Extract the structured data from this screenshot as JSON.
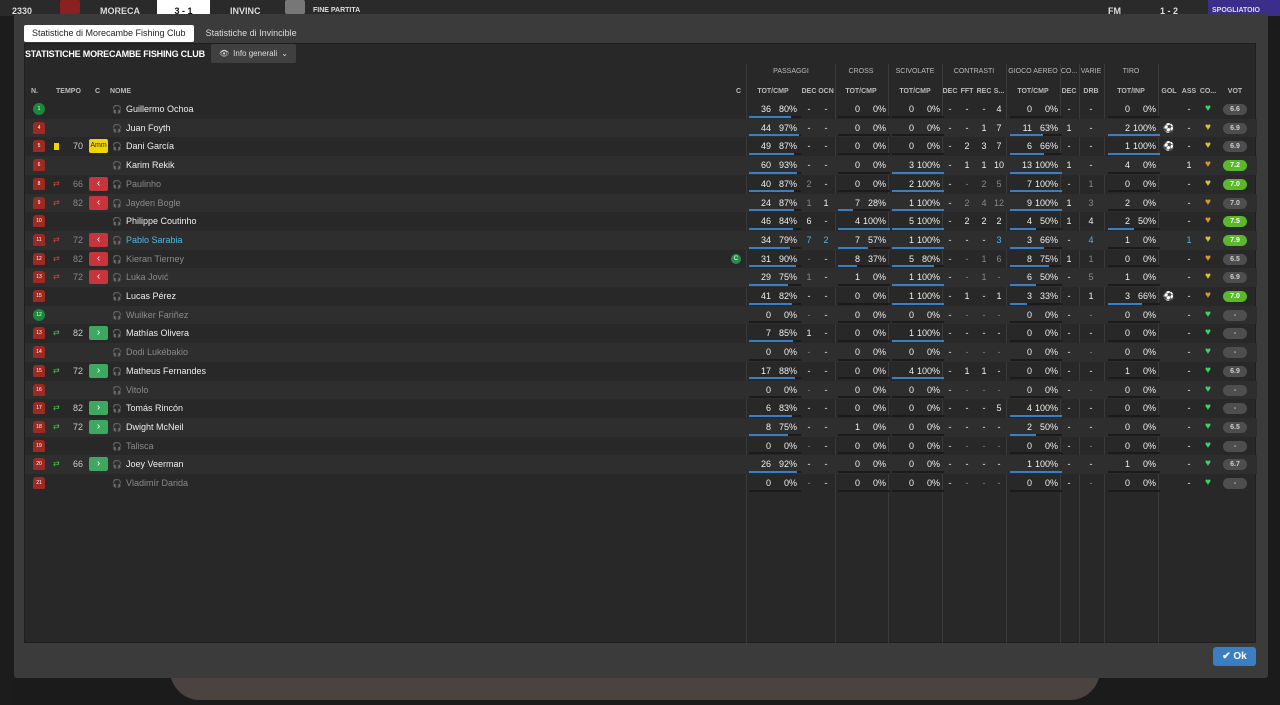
{
  "topbar": {
    "clock": "2330",
    "team1": "MORECA",
    "score": "3 - 1",
    "team2": "INVINC",
    "status": "FINE PARTITA",
    "fm": "FM",
    "right_score": "1 - 2",
    "right_btn": "SPOGLIATOIO"
  },
  "tabs": [
    "Statistiche di Morecambe Fishing Club",
    "Statistiche di Invincible"
  ],
  "panel_title": "STATISTICHE MORECAMBE FISHING CLUB",
  "view_select": "Info generali",
  "groups": [
    "PASSAGGI",
    "CROSS",
    "SCIVOLATE",
    "CONTRASTI",
    "GIOCO AEREO",
    "CO...",
    "VARIE",
    "TIRO"
  ],
  "col_headers": {
    "n": "N.",
    "tempo": "TEMPO",
    "c": "C",
    "nome": "NOME",
    "c2": "C",
    "pas_tc": "TOT/CMP",
    "pas_dec": "DEC",
    "pas_ocn": "OCN",
    "cross_tc": "TOT/CMP",
    "sciv_tc": "TOT/CMP",
    "con_dec": "DEC",
    "con_fft": "FFT",
    "con_rec": "REC",
    "con_s": "S...",
    "aer_tc": "TOT/CMP",
    "co_dec": "DEC",
    "var_drb": "DRB",
    "tiro_ti": "TOT/INP",
    "gol": "GOL",
    "ass": "ASS",
    "co": "CO...",
    "vot": "VOT"
  },
  "players": [
    {
      "num": "1",
      "gk": true,
      "card": "",
      "icon": "",
      "tempo": "",
      "sub": "",
      "name": "Guillermo Ochoa",
      "style": "",
      "cap": "",
      "p": [
        "36",
        "80%"
      ],
      "pdec": "-",
      "pocn": "-",
      "cr": [
        "0",
        "0%"
      ],
      "sc": [
        "0",
        "0%"
      ],
      "cdec": "-",
      "fft": "-",
      "rec": "-",
      "s": "4",
      "ae": [
        "0",
        "0%"
      ],
      "codec": "-",
      "drb": "-",
      "ti": [
        "0",
        "0%"
      ],
      "gol": "",
      "ass": "-",
      "heart": "g",
      "vot": "6.6",
      "votc": "n"
    },
    {
      "num": "4",
      "gk": false,
      "card": "",
      "icon": "",
      "tempo": "",
      "sub": "",
      "name": "Juan Foyth",
      "style": "",
      "cap": "",
      "p": [
        "44",
        "97%"
      ],
      "pdec": "-",
      "pocn": "-",
      "cr": [
        "0",
        "0%"
      ],
      "sc": [
        "0",
        "0%"
      ],
      "cdec": "-",
      "fft": "-",
      "rec": "1",
      "s": "7",
      "ae": [
        "11",
        "63%"
      ],
      "codec": "1",
      "drb": "-",
      "ti": [
        "2",
        "100%"
      ],
      "gol": "⚽",
      "ass": "-",
      "heart": "y",
      "vot": "6.9",
      "votc": "n"
    },
    {
      "num": "5",
      "gk": false,
      "card": "y",
      "icon": "",
      "tempo": "70",
      "sub": "amm",
      "name": "Dani García",
      "style": "",
      "cap": "",
      "p": [
        "49",
        "87%"
      ],
      "pdec": "-",
      "pocn": "-",
      "cr": [
        "0",
        "0%"
      ],
      "sc": [
        "0",
        "0%"
      ],
      "cdec": "-",
      "fft": "2",
      "rec": "3",
      "s": "7",
      "ae": [
        "6",
        "66%"
      ],
      "codec": "-",
      "drb": "-",
      "ti": [
        "1",
        "100%"
      ],
      "gol": "⚽",
      "ass": "-",
      "heart": "y",
      "vot": "6.9",
      "votc": "n"
    },
    {
      "num": "6",
      "gk": false,
      "card": "",
      "icon": "",
      "tempo": "",
      "sub": "",
      "name": "Karim Rekik",
      "style": "",
      "cap": "",
      "p": [
        "60",
        "93%"
      ],
      "pdec": "-",
      "pocn": "-",
      "cr": [
        "0",
        "0%"
      ],
      "sc": [
        "3",
        "100%"
      ],
      "cdec": "-",
      "fft": "1",
      "rec": "1",
      "s": "10",
      "ae": [
        "13",
        "100%"
      ],
      "codec": "1",
      "drb": "-",
      "ti": [
        "4",
        "0%"
      ],
      "gol": "",
      "ass": "1",
      "heart": "o",
      "vot": "7.2",
      "votc": "g"
    },
    {
      "num": "8",
      "gk": false,
      "card": "",
      "icon": "out",
      "tempo": "66",
      "sub": "out",
      "name": "Paulinho",
      "style": "dim",
      "cap": "",
      "p": [
        "40",
        "87%"
      ],
      "pdec": "2",
      "pocn": "-",
      "cr": [
        "0",
        "0%"
      ],
      "sc": [
        "2",
        "100%"
      ],
      "cdec": "-",
      "fft": "-",
      "rec": "2",
      "s": "5",
      "ae": [
        "7",
        "100%"
      ],
      "codec": "-",
      "drb": "1",
      "ti": [
        "0",
        "0%"
      ],
      "gol": "",
      "ass": "-",
      "heart": "y",
      "vot": "7.0",
      "votc": "g"
    },
    {
      "num": "9",
      "gk": false,
      "card": "",
      "icon": "out",
      "tempo": "82",
      "sub": "out",
      "name": "Jayden Bogle",
      "style": "dim",
      "cap": "",
      "p": [
        "24",
        "87%"
      ],
      "pdec": "1",
      "pocn": "1",
      "cr": [
        "7",
        "28%"
      ],
      "sc": [
        "1",
        "100%"
      ],
      "cdec": "-",
      "fft": "2",
      "rec": "4",
      "s": "12",
      "ae": [
        "9",
        "100%"
      ],
      "codec": "1",
      "drb": "3",
      "ti": [
        "2",
        "0%"
      ],
      "gol": "",
      "ass": "-",
      "heart": "o",
      "vot": "7.0",
      "votc": "n"
    },
    {
      "num": "10",
      "gk": false,
      "card": "",
      "icon": "",
      "tempo": "",
      "sub": "",
      "name": "Philippe Coutinho",
      "style": "",
      "cap": "",
      "p": [
        "46",
        "84%"
      ],
      "pdec": "6",
      "pocn": "-",
      "cr": [
        "4",
        "100%"
      ],
      "sc": [
        "5",
        "100%"
      ],
      "cdec": "-",
      "fft": "2",
      "rec": "2",
      "s": "2",
      "ae": [
        "4",
        "50%"
      ],
      "codec": "1",
      "drb": "4",
      "ti": [
        "2",
        "50%"
      ],
      "gol": "",
      "ass": "-",
      "heart": "o",
      "vot": "7.5",
      "votc": "g"
    },
    {
      "num": "11",
      "gk": false,
      "card": "",
      "icon": "out",
      "tempo": "72",
      "sub": "out",
      "name": "Pablo Sarabia",
      "style": "hl",
      "cap": "",
      "p": [
        "34",
        "79%"
      ],
      "pdec": "7",
      "pocn": "2",
      "cr": [
        "7",
        "57%"
      ],
      "sc": [
        "1",
        "100%"
      ],
      "cdec": "-",
      "fft": "-",
      "rec": "-",
      "s": "3",
      "ae": [
        "3",
        "66%"
      ],
      "codec": "-",
      "drb": "4",
      "ti": [
        "1",
        "0%"
      ],
      "gol": "",
      "ass": "1",
      "heart": "y",
      "vot": "7.9",
      "votc": "g"
    },
    {
      "num": "12",
      "gk": false,
      "card": "",
      "icon": "out",
      "tempo": "82",
      "sub": "out",
      "name": "Kieran Tierney",
      "style": "dim",
      "cap": "C",
      "p": [
        "31",
        "90%"
      ],
      "pdec": "-",
      "pocn": "-",
      "cr": [
        "8",
        "37%"
      ],
      "sc": [
        "5",
        "80%"
      ],
      "cdec": "-",
      "fft": "-",
      "rec": "1",
      "s": "6",
      "ae": [
        "8",
        "75%"
      ],
      "codec": "1",
      "drb": "1",
      "ti": [
        "0",
        "0%"
      ],
      "gol": "",
      "ass": "-",
      "heart": "o",
      "vot": "6.5",
      "votc": "n"
    },
    {
      "num": "13",
      "gk": false,
      "card": "",
      "icon": "out",
      "tempo": "72",
      "sub": "out",
      "name": "Luka Jović",
      "style": "dim",
      "cap": "",
      "p": [
        "29",
        "75%"
      ],
      "pdec": "1",
      "pocn": "-",
      "cr": [
        "1",
        "0%"
      ],
      "sc": [
        "1",
        "100%"
      ],
      "cdec": "-",
      "fft": "-",
      "rec": "1",
      "s": "-",
      "ae": [
        "6",
        "50%"
      ],
      "codec": "-",
      "drb": "5",
      "ti": [
        "1",
        "0%"
      ],
      "gol": "",
      "ass": "-",
      "heart": "y",
      "vot": "6.9",
      "votc": "n"
    },
    {
      "num": "15",
      "gk": false,
      "card": "",
      "icon": "",
      "tempo": "",
      "sub": "",
      "name": "Lucas Pérez",
      "style": "",
      "cap": "",
      "p": [
        "41",
        "82%"
      ],
      "pdec": "-",
      "pocn": "-",
      "cr": [
        "0",
        "0%"
      ],
      "sc": [
        "1",
        "100%"
      ],
      "cdec": "-",
      "fft": "1",
      "rec": "-",
      "s": "1",
      "ae": [
        "3",
        "33%"
      ],
      "codec": "-",
      "drb": "1",
      "ti": [
        "3",
        "66%"
      ],
      "gol": "⚽",
      "ass": "-",
      "heart": "o",
      "vot": "7.0",
      "votc": "g"
    },
    {
      "num": "12",
      "gk": true,
      "card": "",
      "icon": "",
      "tempo": "",
      "sub": "",
      "name": "Wuilker Fariñez",
      "style": "dim",
      "cap": "",
      "p": [
        "0",
        "0%"
      ],
      "pdec": "-",
      "pocn": "-",
      "cr": [
        "0",
        "0%"
      ],
      "sc": [
        "0",
        "0%"
      ],
      "cdec": "-",
      "fft": "-",
      "rec": "-",
      "s": "-",
      "ae": [
        "0",
        "0%"
      ],
      "codec": "-",
      "drb": "-",
      "ti": [
        "0",
        "0%"
      ],
      "gol": "",
      "ass": "-",
      "heart": "g",
      "vot": "-",
      "votc": "n"
    },
    {
      "num": "13",
      "gk": false,
      "card": "",
      "icon": "in",
      "tempo": "82",
      "sub": "in",
      "name": "Mathías Olivera",
      "style": "",
      "cap": "",
      "p": [
        "7",
        "85%"
      ],
      "pdec": "1",
      "pocn": "-",
      "cr": [
        "0",
        "0%"
      ],
      "sc": [
        "1",
        "100%"
      ],
      "cdec": "-",
      "fft": "-",
      "rec": "-",
      "s": "-",
      "ae": [
        "0",
        "0%"
      ],
      "codec": "-",
      "drb": "-",
      "ti": [
        "0",
        "0%"
      ],
      "gol": "",
      "ass": "-",
      "heart": "g",
      "vot": "-",
      "votc": "n"
    },
    {
      "num": "14",
      "gk": false,
      "card": "",
      "icon": "",
      "tempo": "",
      "sub": "",
      "name": "Dodi Lukébakio",
      "style": "dim",
      "cap": "",
      "p": [
        "0",
        "0%"
      ],
      "pdec": "-",
      "pocn": "-",
      "cr": [
        "0",
        "0%"
      ],
      "sc": [
        "0",
        "0%"
      ],
      "cdec": "-",
      "fft": "-",
      "rec": "-",
      "s": "-",
      "ae": [
        "0",
        "0%"
      ],
      "codec": "-",
      "drb": "-",
      "ti": [
        "0",
        "0%"
      ],
      "gol": "",
      "ass": "-",
      "heart": "g",
      "vot": "-",
      "votc": "n"
    },
    {
      "num": "15",
      "gk": false,
      "card": "",
      "icon": "in",
      "tempo": "72",
      "sub": "in",
      "name": "Matheus Fernandes",
      "style": "",
      "cap": "",
      "p": [
        "17",
        "88%"
      ],
      "pdec": "-",
      "pocn": "-",
      "cr": [
        "0",
        "0%"
      ],
      "sc": [
        "4",
        "100%"
      ],
      "cdec": "-",
      "fft": "1",
      "rec": "1",
      "s": "-",
      "ae": [
        "0",
        "0%"
      ],
      "codec": "-",
      "drb": "-",
      "ti": [
        "1",
        "0%"
      ],
      "gol": "",
      "ass": "-",
      "heart": "g",
      "vot": "6.9",
      "votc": "n"
    },
    {
      "num": "16",
      "gk": false,
      "card": "",
      "icon": "",
      "tempo": "",
      "sub": "",
      "name": "Vitolo",
      "style": "dim",
      "cap": "",
      "p": [
        "0",
        "0%"
      ],
      "pdec": "-",
      "pocn": "-",
      "cr": [
        "0",
        "0%"
      ],
      "sc": [
        "0",
        "0%"
      ],
      "cdec": "-",
      "fft": "-",
      "rec": "-",
      "s": "-",
      "ae": [
        "0",
        "0%"
      ],
      "codec": "-",
      "drb": "-",
      "ti": [
        "0",
        "0%"
      ],
      "gol": "",
      "ass": "-",
      "heart": "g",
      "vot": "-",
      "votc": "n"
    },
    {
      "num": "17",
      "gk": false,
      "card": "",
      "icon": "in",
      "tempo": "82",
      "sub": "in",
      "name": "Tomás Rincón",
      "style": "",
      "cap": "",
      "p": [
        "6",
        "83%"
      ],
      "pdec": "-",
      "pocn": "-",
      "cr": [
        "0",
        "0%"
      ],
      "sc": [
        "0",
        "0%"
      ],
      "cdec": "-",
      "fft": "-",
      "rec": "-",
      "s": "5",
      "ae": [
        "4",
        "100%"
      ],
      "codec": "-",
      "drb": "-",
      "ti": [
        "0",
        "0%"
      ],
      "gol": "",
      "ass": "-",
      "heart": "g",
      "vot": "-",
      "votc": "n"
    },
    {
      "num": "18",
      "gk": false,
      "card": "",
      "icon": "in",
      "tempo": "72",
      "sub": "in",
      "name": "Dwight McNeil",
      "style": "",
      "cap": "",
      "p": [
        "8",
        "75%"
      ],
      "pdec": "-",
      "pocn": "-",
      "cr": [
        "1",
        "0%"
      ],
      "sc": [
        "0",
        "0%"
      ],
      "cdec": "-",
      "fft": "-",
      "rec": "-",
      "s": "-",
      "ae": [
        "2",
        "50%"
      ],
      "codec": "-",
      "drb": "-",
      "ti": [
        "0",
        "0%"
      ],
      "gol": "",
      "ass": "-",
      "heart": "g",
      "vot": "6.5",
      "votc": "n"
    },
    {
      "num": "19",
      "gk": false,
      "card": "",
      "icon": "",
      "tempo": "",
      "sub": "",
      "name": "Talisca",
      "style": "dim",
      "cap": "",
      "p": [
        "0",
        "0%"
      ],
      "pdec": "-",
      "pocn": "-",
      "cr": [
        "0",
        "0%"
      ],
      "sc": [
        "0",
        "0%"
      ],
      "cdec": "-",
      "fft": "-",
      "rec": "-",
      "s": "-",
      "ae": [
        "0",
        "0%"
      ],
      "codec": "-",
      "drb": "-",
      "ti": [
        "0",
        "0%"
      ],
      "gol": "",
      "ass": "-",
      "heart": "g",
      "vot": "-",
      "votc": "n"
    },
    {
      "num": "20",
      "gk": false,
      "card": "",
      "icon": "in",
      "tempo": "66",
      "sub": "in",
      "name": "Joey Veerman",
      "style": "",
      "cap": "",
      "p": [
        "26",
        "92%"
      ],
      "pdec": "-",
      "pocn": "-",
      "cr": [
        "0",
        "0%"
      ],
      "sc": [
        "0",
        "0%"
      ],
      "cdec": "-",
      "fft": "-",
      "rec": "-",
      "s": "-",
      "ae": [
        "1",
        "100%"
      ],
      "codec": "-",
      "drb": "-",
      "ti": [
        "1",
        "0%"
      ],
      "gol": "",
      "ass": "-",
      "heart": "g",
      "vot": "6.7",
      "votc": "n"
    },
    {
      "num": "21",
      "gk": false,
      "card": "",
      "icon": "",
      "tempo": "",
      "sub": "",
      "name": "Vladimír Darida",
      "style": "dim",
      "cap": "",
      "p": [
        "0",
        "0%"
      ],
      "pdec": "-",
      "pocn": "-",
      "cr": [
        "0",
        "0%"
      ],
      "sc": [
        "0",
        "0%"
      ],
      "cdec": "-",
      "fft": "-",
      "rec": "-",
      "s": "-",
      "ae": [
        "0",
        "0%"
      ],
      "codec": "-",
      "drb": "-",
      "ti": [
        "0",
        "0%"
      ],
      "gol": "",
      "ass": "-",
      "heart": "g",
      "vot": "-",
      "votc": "n"
    }
  ],
  "ok_label": "Ok",
  "colors": {
    "accent": "#3c7ec2",
    "sub_out": "#c8343b",
    "sub_in": "#3fa860",
    "rating_good": "#5ab82a",
    "heart": "#39d86a",
    "kit": "#9a2a22"
  }
}
